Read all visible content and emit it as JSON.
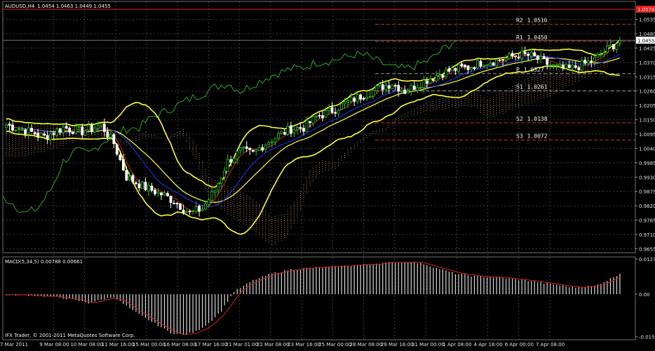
{
  "chart_data": [
    {
      "type": "candlestick",
      "title": "AUDUSD,H4",
      "ohlc_text": "1.0454 1.0463 1.0449 1.0455",
      "current_price_label": "1.0455",
      "top_price_label": "1.0574",
      "ylim": [
        0.964,
        1.0585
      ],
      "y_ticks": [
        "1.0535",
        "1.0480",
        "1.0425",
        "1.0370",
        "1.0315",
        "1.0260",
        "1.0205",
        "1.0150",
        "1.0095",
        "1.0040",
        "0.9985",
        "0.9930",
        "0.9875",
        "0.9820",
        "0.9765",
        "0.9710",
        "0.9655"
      ],
      "x_ticks": [
        "7 Mar 2011",
        "9 Mar 08:00",
        "10 Mar 08:00",
        "11 Mar 16:00",
        "15 Mar 00:00",
        "16 Mar 08:00",
        "17 Mar 16:00",
        "21 Mar 01:00",
        "22 Mar 08:00",
        "23 Mar 16:00",
        "25 Mar 00:00",
        "28 Mar 08:00",
        "29 Mar 16:00",
        "31 Mar 00:00",
        "1 Apr 08:00",
        "4 Apr 16:00",
        "6 Apr 00:00",
        "7 Apr 08:00"
      ],
      "grid": true,
      "pivot_levels": [
        {
          "label": "R2",
          "value": "1.0516",
          "color": "#c83232"
        },
        {
          "label": "R1",
          "value": "1.0450",
          "color": "#c83232"
        },
        {
          "label": "P",
          "value": "1.0327",
          "color": "#9a9a9a"
        },
        {
          "label": "S1",
          "value": "1.0261",
          "color": "#9a9a9a"
        },
        {
          "label": "S2",
          "value": "1.0138",
          "color": "#c83232"
        },
        {
          "label": "S3",
          "value": "1.0072",
          "color": "#c83232"
        }
      ],
      "close_anchors": [
        [
          0,
          1.013
        ],
        [
          6,
          1.011
        ],
        [
          12,
          1.0085
        ],
        [
          18,
          1.012
        ],
        [
          24,
          1.0105
        ],
        [
          30,
          1.013
        ],
        [
          34,
          1.006
        ],
        [
          38,
          0.993
        ],
        [
          44,
          0.989
        ],
        [
          50,
          0.986
        ],
        [
          54,
          0.983
        ],
        [
          58,
          0.979
        ],
        [
          62,
          0.981
        ],
        [
          66,
          0.988
        ],
        [
          70,
          0.999
        ],
        [
          74,
          1.003
        ],
        [
          78,
          1.002
        ],
        [
          82,
          1.006
        ],
        [
          86,
          1.009
        ],
        [
          90,
          1.0115
        ],
        [
          94,
          1.012
        ],
        [
          98,
          1.016
        ],
        [
          102,
          1.018
        ],
        [
          106,
          1.0205
        ],
        [
          110,
          1.023
        ],
        [
          114,
          1.025
        ],
        [
          118,
          1.0275
        ],
        [
          122,
          1.029
        ],
        [
          126,
          1.026
        ],
        [
          130,
          1.0285
        ],
        [
          134,
          1.031
        ],
        [
          138,
          1.033
        ],
        [
          142,
          1.0345
        ],
        [
          146,
          1.035
        ],
        [
          150,
          1.037
        ],
        [
          154,
          1.0375
        ],
        [
          158,
          1.0385
        ],
        [
          162,
          1.04
        ],
        [
          166,
          1.0395
        ],
        [
          170,
          1.037
        ],
        [
          174,
          1.035
        ],
        [
          178,
          1.0345
        ],
        [
          182,
          1.036
        ],
        [
          186,
          1.038
        ],
        [
          190,
          1.042
        ],
        [
          194,
          1.0455
        ]
      ],
      "indicator_colors": {
        "bollinger": "#ffff33",
        "chikou": "#22aa22",
        "tenkan": "#cc2222",
        "kijun": "#2233ff",
        "cloud": "#d9a07a",
        "bull_candle": "#22c422",
        "bear_candle": "#ffffff"
      }
    },
    {
      "type": "bar",
      "title": "MACD(5,34,5) 0.00788 0.00661",
      "ylim": [
        -0.0165,
        0.0135
      ],
      "y_ticks": [
        "0.01278",
        "0.00",
        "-0.0154"
      ],
      "hist_anchors": [
        [
          0,
          -0.0002
        ],
        [
          8,
          -0.0004
        ],
        [
          16,
          -0.001
        ],
        [
          22,
          -0.0022
        ],
        [
          26,
          -0.0032
        ],
        [
          30,
          -0.002
        ],
        [
          34,
          -0.001
        ],
        [
          40,
          -0.006
        ],
        [
          46,
          -0.01
        ],
        [
          52,
          -0.014
        ],
        [
          56,
          -0.0148
        ],
        [
          60,
          -0.0135
        ],
        [
          64,
          -0.0105
        ],
        [
          68,
          -0.006
        ],
        [
          72,
          0.001
        ],
        [
          78,
          0.005
        ],
        [
          84,
          0.0075
        ],
        [
          90,
          0.009
        ],
        [
          96,
          0.0095
        ],
        [
          104,
          0.01
        ],
        [
          110,
          0.0105
        ],
        [
          116,
          0.011
        ],
        [
          122,
          0.0115
        ],
        [
          128,
          0.0118
        ],
        [
          132,
          0.011
        ],
        [
          136,
          0.0095
        ],
        [
          142,
          0.0075
        ],
        [
          148,
          0.0065
        ],
        [
          154,
          0.0062
        ],
        [
          160,
          0.0055
        ],
        [
          166,
          0.0048
        ],
        [
          170,
          0.004
        ],
        [
          176,
          0.003
        ],
        [
          180,
          0.0025
        ],
        [
          186,
          0.003
        ],
        [
          190,
          0.005
        ],
        [
          194,
          0.0075
        ]
      ],
      "colors": {
        "histogram": "#d9d9d9",
        "signal": "#cc2222"
      }
    }
  ],
  "footer": {
    "copyright": "IFX Trader, © 2001-2011 MetaQuotes Software Corp."
  }
}
